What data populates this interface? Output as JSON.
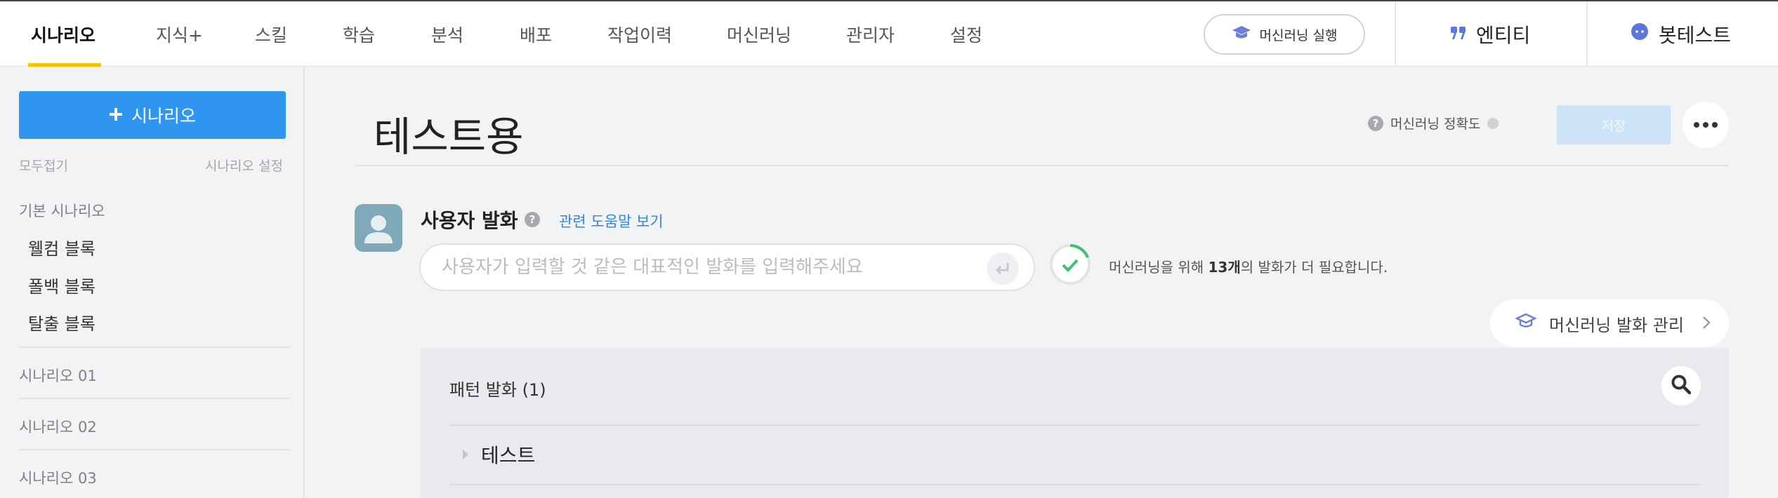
{
  "nav": {
    "tabs": [
      {
        "label": "시나리오",
        "active": true
      },
      {
        "label": "지식+"
      },
      {
        "label": "스킬"
      },
      {
        "label": "학습"
      },
      {
        "label": "분석"
      },
      {
        "label": "배포"
      },
      {
        "label": "작업이력"
      },
      {
        "label": "머신러닝"
      },
      {
        "label": "관리자"
      },
      {
        "label": "설정"
      }
    ],
    "ml_run_label": "머신러닝 실행",
    "entity_label": "엔티티",
    "bottest_label": "봇테스트"
  },
  "sidebar": {
    "add_label": "시나리오",
    "collapse_all": "모두접기",
    "scenario_settings": "시나리오 설정",
    "basic_group": "기본 시나리오",
    "items": [
      {
        "label": "웰컴 블록"
      },
      {
        "label": "폴백 블록"
      },
      {
        "label": "탈출 블록"
      }
    ],
    "scenarios": [
      {
        "label": "시나리오 01"
      },
      {
        "label": "시나리오 02"
      },
      {
        "label": "시나리오 03"
      }
    ]
  },
  "main": {
    "title": "테스트용",
    "accuracy_label": "머신러닝 정확도",
    "save_label": "저장",
    "utterance_label": "사용자 발화",
    "help_link": "관련 도움말 보기",
    "input_placeholder": "사용자가 입력할 것 같은 대표적인 발화를 입력해주세요",
    "ml_need_prefix": "머신러닝을 위해 ",
    "ml_need_count": "13개",
    "ml_need_suffix": "의 발화가 더 필요합니다.",
    "ml_manage_label": "머신러닝 발화 관리",
    "pattern_title": "패턴 발화 (1)",
    "pattern_items": [
      {
        "label": "테스트"
      }
    ]
  },
  "colors": {
    "accent_blue": "#2f96f0",
    "active_underline": "#f5c400",
    "check_green": "#3cc06a",
    "link_blue": "#2f86e0"
  },
  "icons": [
    "graduation-cap-icon",
    "quote-icon",
    "chat-bubble-icon",
    "plus-icon",
    "question-icon",
    "more-icon",
    "user-avatar-icon",
    "enter-icon",
    "check-icon",
    "chevron-right-icon",
    "search-icon"
  ]
}
